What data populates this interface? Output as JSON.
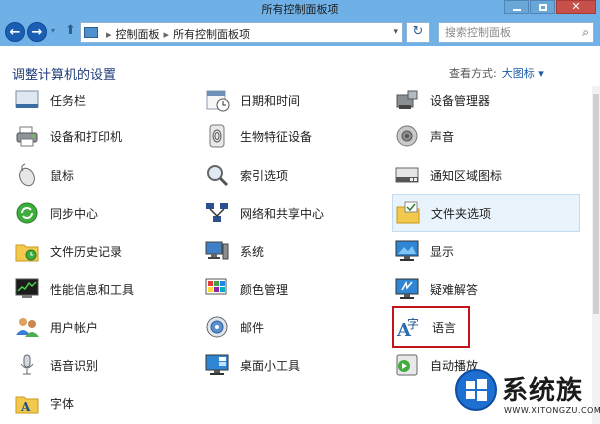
{
  "window": {
    "title": "所有控制面板项",
    "accent_color": "#6fb1e6",
    "close_color": "#c7504b"
  },
  "toolbar": {
    "back_icon": "back-arrow-icon",
    "forward_icon": "forward-arrow-icon",
    "back_glyph": "←",
    "forward_glyph": "→",
    "up_glyph": "⬆",
    "refresh_glyph": "↻"
  },
  "address": {
    "crumbs": [
      "控制面板",
      "所有控制面板项"
    ],
    "separator": "▸"
  },
  "search": {
    "placeholder": "搜索控制面板"
  },
  "header": {
    "title": "调整计算机的设置",
    "view_by_label": "查看方式:",
    "view_by_value": "大图标 ▾"
  },
  "items": [
    {
      "label": "任务栏",
      "icon": "taskbar-icon"
    },
    {
      "label": "日期和时间",
      "icon": "calendar-clock-icon"
    },
    {
      "label": "设备管理器",
      "icon": "device-manager-icon"
    },
    {
      "label": "设备和打印机",
      "icon": "printer-icon"
    },
    {
      "label": "生物特征设备",
      "icon": "fingerprint-icon"
    },
    {
      "label": "声音",
      "icon": "speaker-icon"
    },
    {
      "label": "鼠标",
      "icon": "mouse-icon"
    },
    {
      "label": "索引选项",
      "icon": "indexing-magnifier-icon"
    },
    {
      "label": "通知区域图标",
      "icon": "notification-area-icon"
    },
    {
      "label": "同步中心",
      "icon": "sync-center-icon"
    },
    {
      "label": "网络和共享中心",
      "icon": "network-icon"
    },
    {
      "label": "文件夹选项",
      "icon": "folder-options-icon"
    },
    {
      "label": "文件历史记录",
      "icon": "file-history-icon"
    },
    {
      "label": "系统",
      "icon": "system-computer-icon"
    },
    {
      "label": "显示",
      "icon": "display-monitor-icon"
    },
    {
      "label": "性能信息和工具",
      "icon": "performance-icon"
    },
    {
      "label": "颜色管理",
      "icon": "color-management-icon"
    },
    {
      "label": "疑难解答",
      "icon": "troubleshooting-icon"
    },
    {
      "label": "用户帐户",
      "icon": "user-accounts-icon"
    },
    {
      "label": "邮件",
      "icon": "mail-icon"
    },
    {
      "label": "语言",
      "icon": "language-icon"
    },
    {
      "label": "语音识别",
      "icon": "microphone-icon"
    },
    {
      "label": "桌面小工具",
      "icon": "desktop-gadgets-icon"
    },
    {
      "label": "自动播放",
      "icon": "autoplay-icon"
    },
    {
      "label": "字体",
      "icon": "fonts-icon"
    }
  ],
  "watermark": {
    "text": "系统族",
    "url": "WWW.XITONGZU.COM"
  }
}
